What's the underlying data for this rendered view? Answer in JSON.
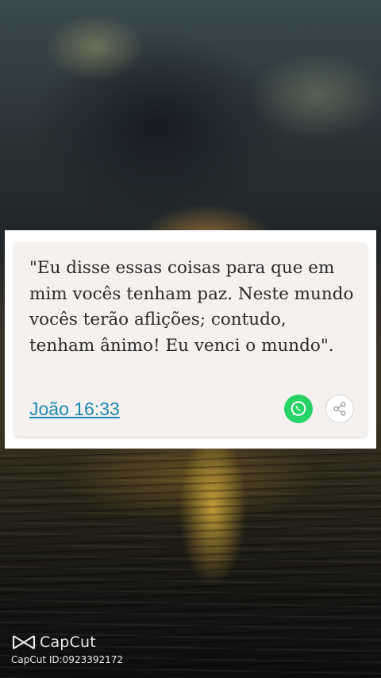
{
  "verse": {
    "text": "\"Eu disse essas coisas para que em mim vocês tenham paz. Neste mundo vocês terão aflições; contudo, tenham ânimo! Eu venci o mundo\".",
    "reference": "João 16:33"
  },
  "actions": {
    "whatsapp_icon": "whatsapp-icon",
    "share_icon": "share-icon"
  },
  "watermark": {
    "brand": "CapCut",
    "id_text": "CapCut ID:0923392172"
  },
  "colors": {
    "link": "#1d8ab3",
    "whatsapp": "#25d366",
    "card_bg": "#f4f1ef"
  }
}
